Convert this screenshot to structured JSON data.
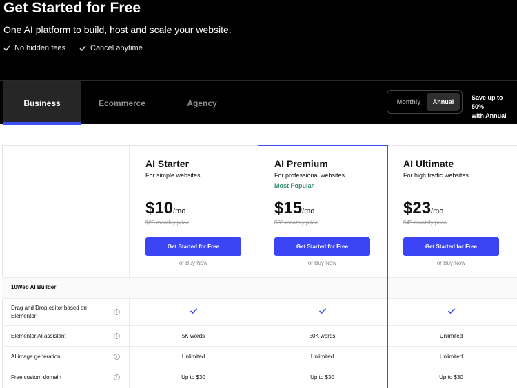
{
  "hero": {
    "title": "Get Started for Free",
    "subtitle": "One AI platform to build, host and scale your website.",
    "perks": [
      "No hidden fees",
      "Cancel anytime"
    ]
  },
  "tabs": [
    "Business",
    "Ecommerce",
    "Agency"
  ],
  "billing": {
    "options": [
      "Monthly",
      "Annual"
    ],
    "selected": "Annual",
    "save_line1": "Save up to 50%",
    "save_line2": "with Annual"
  },
  "plans": [
    {
      "name": "AI Starter",
      "desc": "For simple websites",
      "badge": "",
      "price": "$10",
      "period": "/mo",
      "old": "$20 monthly price",
      "cta": "Get Started for Free",
      "buy": "or Buy Now"
    },
    {
      "name": "AI Premium",
      "desc": "For professional websites",
      "badge": "Most Popular",
      "price": "$15",
      "period": "/mo",
      "old": "$30 monthly price",
      "cta": "Get Started for Free",
      "buy": "or Buy Now"
    },
    {
      "name": "AI Ultimate",
      "desc": "For high traffic websites",
      "badge": "",
      "price": "$23",
      "period": "/mo",
      "old": "$45 monthly price",
      "cta": "Get Started for Free",
      "buy": "or Buy Now"
    }
  ],
  "features": {
    "group": "10Web AI Builder",
    "rows": [
      {
        "label": "Drag and Drop editor based on Elementor",
        "values": [
          "check",
          "check",
          "check"
        ]
      },
      {
        "label": "Elementor AI assistant",
        "values": [
          "5K words",
          "50K words",
          "Unlimited"
        ]
      },
      {
        "label": "AI image generation",
        "values": [
          "Unlimited",
          "Unlimited",
          "Unlimited"
        ]
      },
      {
        "label": "Free custom domain",
        "values": [
          "Up to $30",
          "Up to $30",
          "Up to $30"
        ]
      }
    ]
  },
  "colors": {
    "accent": "#3b45f5",
    "popular": "#2e8b6e",
    "hero_bg": "#000000"
  }
}
